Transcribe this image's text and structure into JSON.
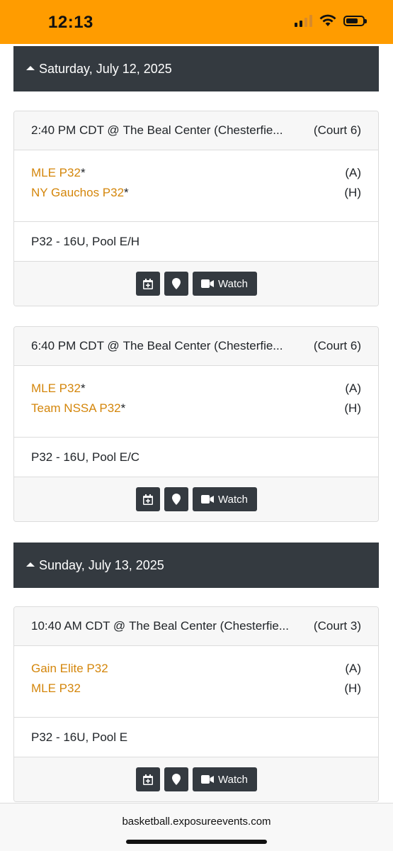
{
  "status": {
    "time": "12:13"
  },
  "days": [
    {
      "label": "Saturday, July 12, 2025"
    },
    {
      "label": "Sunday, July 13, 2025"
    }
  ],
  "games": [
    {
      "time": "2:40 PM CDT @",
      "venue": "The Beal Center (Chesterfie...",
      "court": "(Court 6)",
      "team1": "MLE P32",
      "team1_star": "*",
      "team1_side": "(A)",
      "team2": "NY Gauchos P32",
      "team2_star": "*",
      "team2_side": "(H)",
      "division": "P32 - 16U, Pool E/H",
      "watch_label": "Watch"
    },
    {
      "time": "6:40 PM CDT @",
      "venue": "The Beal Center (Chesterfie...",
      "court": "(Court 6)",
      "team1": "MLE P32",
      "team1_star": "*",
      "team1_side": "(A)",
      "team2": "Team NSSA P32",
      "team2_star": "*",
      "team2_side": "(H)",
      "division": "P32 - 16U, Pool E/C",
      "watch_label": "Watch"
    },
    {
      "time": "10:40 AM CDT @",
      "venue": "The Beal Center (Chesterfie...",
      "court": "(Court 3)",
      "team1": "Gain Elite P32",
      "team1_star": "",
      "team1_side": "(A)",
      "team2": "MLE P32",
      "team2_star": "",
      "team2_side": "(H)",
      "division": "P32 - 16U, Pool E",
      "watch_label": "Watch"
    }
  ],
  "browser": {
    "url": "basketball.exposureevents.com"
  },
  "icons": {
    "add_calendar": "calendar-plus-icon",
    "location": "map-pin-icon",
    "video": "video-camera-icon",
    "caret": "caret-up-icon"
  },
  "colors": {
    "status_bar": "#ff9c00",
    "header": "#343a40",
    "team_link": "#d4860b"
  }
}
